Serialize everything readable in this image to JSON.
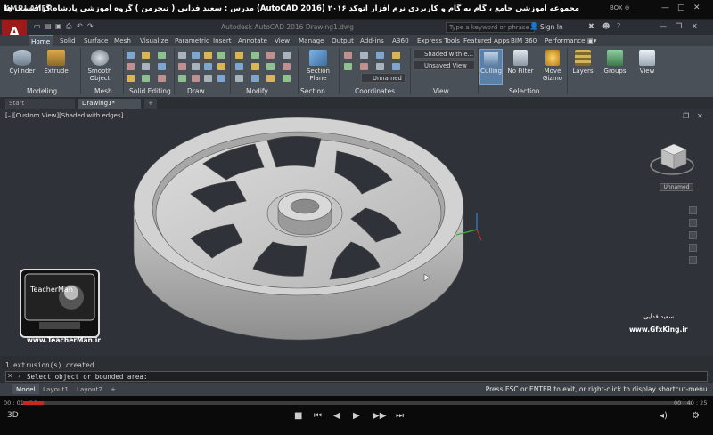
{
  "player": {
    "logo": "KMPLAYER",
    "title": "مجموعه آموزشی جامع ، گام به گام و کاربردی نرم افزار اتوکد ۲۰۱۶ (AutoCAD 2016) مدرس : سعید فدایی ( تیچرمن ) گروه آموزشی پادشاه گرافیست ها",
    "box": "BOX ⊕",
    "time_elapsed": "00 : 01 : 16",
    "time_total": "00 : 40 : 25",
    "progress": 0.03
  },
  "acad": {
    "logo": "A",
    "doc_title": "Autodesk AutoCAD 2016   Drawing1.dwg",
    "search_placeholder": "Type a keyword or phrase",
    "sign_in": "Sign In"
  },
  "tabs": [
    "Home",
    "Solid",
    "Surface",
    "Mesh",
    "Visualize",
    "Parametric",
    "Insert",
    "Annotate",
    "View",
    "Manage",
    "Output",
    "Add-ins",
    "A360",
    "Express Tools",
    "Featured Apps",
    "BIM 360",
    "Performance"
  ],
  "ribbon": {
    "cylinder": "Cylinder",
    "extrude": "Extrude",
    "smooth_object": "Smooth Object",
    "section_plane": "Section Plane",
    "visual_style": "Shaded with e...",
    "view_preset": "Unsaved View",
    "ucs": "Unnamed",
    "culling": "Culling",
    "no_filter": "No Filter",
    "move_gizmo": "Move Gizmo",
    "layers": "Layers",
    "groups": "Groups",
    "view": "View"
  },
  "panels": [
    "Modeling",
    "Mesh",
    "Solid Editing",
    "Draw",
    "Modify",
    "Section",
    "Coordinates",
    "View",
    "Selection"
  ],
  "file_tabs": [
    "Start",
    "Drawing1*"
  ],
  "viewport": {
    "label": "[–][Custom View][Shaded with edges]",
    "cube_label": "Unnamed"
  },
  "watermarks": {
    "teacherman_site": "www.TeacherMan.ir",
    "teacherman_name": "TeacherMan",
    "gfx_site": "www.GfxKing.ir",
    "gfx_name": "سعید فدایی"
  },
  "command": {
    "history": "1 extrusion(s) created",
    "prompt": "Select object or bounded area:"
  },
  "layout_tabs": [
    "Model",
    "Layout1",
    "Layout2"
  ],
  "status_hint": "Press ESC or ENTER to exit, or right-click to display shortcut-menu."
}
